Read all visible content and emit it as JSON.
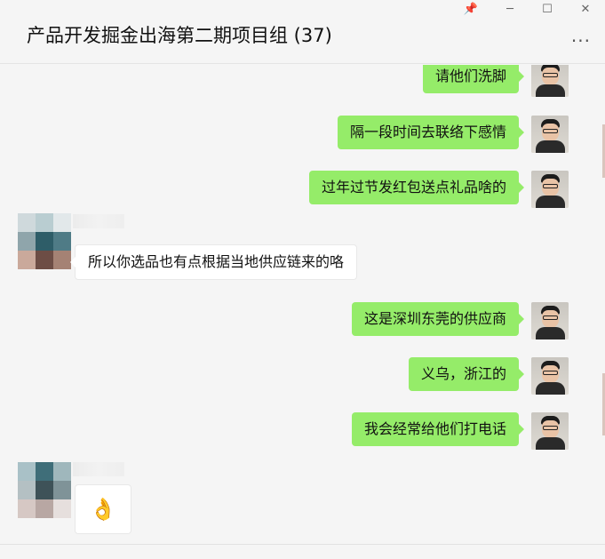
{
  "window": {
    "title": "产品开发掘金出海第二期项目组 (37)",
    "pin_icon": "📌",
    "minimize_icon": "─",
    "maximize_icon": "☐",
    "close_icon": "✕",
    "more_icon": "···"
  },
  "messages": [
    {
      "from": "me",
      "text": "请他们洗脚"
    },
    {
      "from": "me",
      "text": "隔一段时间去联络下感情"
    },
    {
      "from": "me",
      "text": "过年过节发红包送点礼品啥的"
    },
    {
      "from": "other",
      "text": "所以你选品也有点根据当地供应链来的咯"
    },
    {
      "from": "me",
      "text": "这是深圳东莞的供应商"
    },
    {
      "from": "me",
      "text": "义乌，浙江的"
    },
    {
      "from": "me",
      "text": "我会经常给他们打电话"
    },
    {
      "from": "other",
      "text": "👌"
    }
  ],
  "colors": {
    "me_bubble": "#95ec69",
    "other_bubble": "#ffffff",
    "background": "#f5f5f5"
  }
}
